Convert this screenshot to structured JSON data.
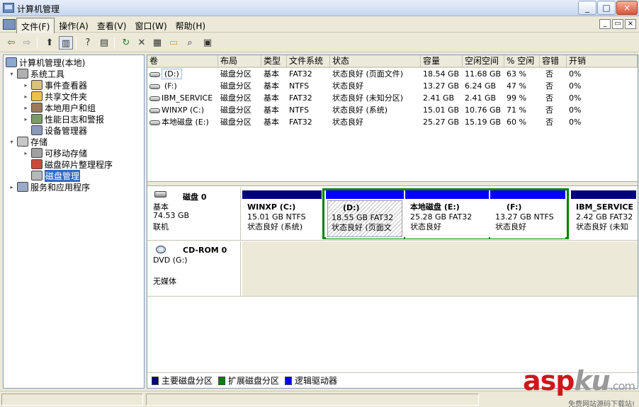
{
  "window": {
    "title": "计算机管理",
    "buttons": [
      "_",
      "□",
      "×"
    ]
  },
  "menu": {
    "items": [
      "文件(F)",
      "操作(A)",
      "查看(V)",
      "窗口(W)",
      "帮助(H)"
    ],
    "active_index": 0,
    "mdi_buttons": [
      "_",
      "▭",
      "×"
    ]
  },
  "toolbar": {
    "icons": [
      "back-arrow-icon",
      "forward-arrow-icon",
      "up-folder-icon",
      "show-tree-icon",
      "help-book-icon",
      "properties-icon",
      "refresh-icon",
      "delete-icon",
      "properties-sheet-icon",
      "open-folder-icon",
      "search-disk-icon",
      "settings-icon"
    ]
  },
  "tree": {
    "nodes": [
      {
        "label": "计算机管理(本地)",
        "level": 0,
        "expander": "",
        "icon": "computer-icon"
      },
      {
        "label": "系统工具",
        "level": 1,
        "expander": "▾",
        "icon": "tools-icon"
      },
      {
        "label": "事件查看器",
        "level": 2,
        "expander": "▸",
        "icon": "event-viewer-icon"
      },
      {
        "label": "共享文件夹",
        "level": 2,
        "expander": "▸",
        "icon": "shared-folder-icon"
      },
      {
        "label": "本地用户和组",
        "level": 2,
        "expander": "▸",
        "icon": "users-icon"
      },
      {
        "label": "性能日志和警报",
        "level": 2,
        "expander": "▸",
        "icon": "performance-icon"
      },
      {
        "label": "设备管理器",
        "level": 2,
        "expander": "",
        "icon": "device-manager-icon"
      },
      {
        "label": "存储",
        "level": 1,
        "expander": "▾",
        "icon": "storage-icon"
      },
      {
        "label": "可移动存储",
        "level": 2,
        "expander": "▸",
        "icon": "removable-storage-icon"
      },
      {
        "label": "磁盘碎片整理程序",
        "level": 2,
        "expander": "",
        "icon": "defrag-icon"
      },
      {
        "label": "磁盘管理",
        "level": 2,
        "expander": "",
        "icon": "disk-management-icon",
        "selected": true
      },
      {
        "label": "服务和应用程序",
        "level": 1,
        "expander": "▸",
        "icon": "services-icon"
      }
    ]
  },
  "volumes": {
    "columns": [
      "卷",
      "布局",
      "类型",
      "文件系统",
      "状态",
      "容量",
      "空闲空间",
      "% 空闲",
      "容错",
      "开销"
    ],
    "rows": [
      [
        "(D:)",
        "磁盘分区",
        "基本",
        "FAT32",
        "状态良好 (页面文件)",
        "18.54 GB",
        "11.68 GB",
        "63 %",
        "否",
        "0%"
      ],
      [
        "(F:)",
        "磁盘分区",
        "基本",
        "NTFS",
        "状态良好",
        "13.27 GB",
        "6.24 GB",
        "47 %",
        "否",
        "0%"
      ],
      [
        "IBM_SERVICE",
        "磁盘分区",
        "基本",
        "FAT32",
        "状态良好 (未知分区)",
        "2.41 GB",
        "2.41 GB",
        "99 %",
        "否",
        "0%"
      ],
      [
        "WINXP (C:)",
        "磁盘分区",
        "基本",
        "NTFS",
        "状态良好 (系统)",
        "15.01 GB",
        "10.76 GB",
        "71 %",
        "否",
        "0%"
      ],
      [
        "本地磁盘 (E:)",
        "磁盘分区",
        "基本",
        "FAT32",
        "状态良好",
        "25.27 GB",
        "15.19 GB",
        "60 %",
        "否",
        "0%"
      ]
    ]
  },
  "disk0": {
    "name": "磁盘 0",
    "type": "基本",
    "size": "74.53 GB",
    "status": "联机",
    "partitions": [
      {
        "name": "WINXP  (C:)",
        "size_fs": "15.01 GB NTFS",
        "status": "状态良好 (系统)"
      },
      {
        "name": "(D:)",
        "size_fs": "18.55 GB FAT32",
        "status": "状态良好 (页面文"
      },
      {
        "name": "本地磁盘  (E:)",
        "size_fs": "25.28 GB FAT32",
        "status": "状态良好"
      },
      {
        "name": "(F:)",
        "size_fs": "13.27 GB NTFS",
        "status": "状态良好"
      },
      {
        "name": "IBM_SERVICE",
        "size_fs": "2.42 GB FAT32",
        "status": "状态良好 (未知"
      }
    ]
  },
  "cdrom0": {
    "name": "CD-ROM 0",
    "type": "DVD (G:)",
    "status": "无媒体"
  },
  "legend": [
    {
      "label": "主要磁盘分区",
      "color": "#000080"
    },
    {
      "label": "扩展磁盘分区",
      "color": "#008000"
    },
    {
      "label": "逻辑驱动器",
      "color": "#0000ff"
    }
  ],
  "watermark": {
    "brand_asp": "asp",
    "brand_ku": "ku",
    "brand_com": ".com",
    "tagline": "免费网站源码下载站!"
  }
}
